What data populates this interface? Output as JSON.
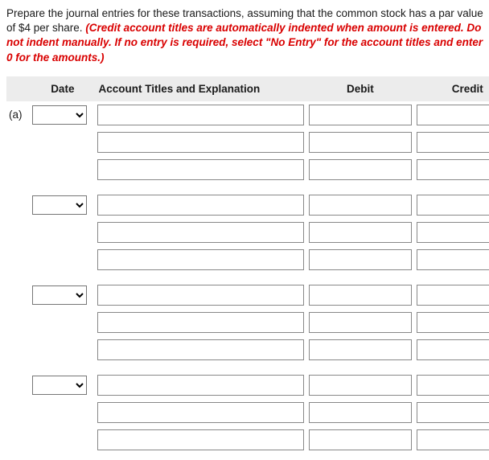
{
  "instructions": {
    "lead": "Prepare the journal entries for these transactions, assuming that the common stock has a par value of $4 per share. ",
    "warn": "(Credit account titles are automatically indented when amount is entered. Do not indent manually. If no entry is required, select \"No Entry\" for the account titles and enter 0 for the amounts.)"
  },
  "headers": {
    "date": "Date",
    "account": "Account Titles and Explanation",
    "debit": "Debit",
    "credit": "Credit"
  },
  "part_label": "(a)",
  "groups": [
    {
      "date": "",
      "rows": [
        {
          "account": "",
          "debit": "",
          "credit": ""
        },
        {
          "account": "",
          "debit": "",
          "credit": ""
        },
        {
          "account": "",
          "debit": "",
          "credit": ""
        }
      ]
    },
    {
      "date": "",
      "rows": [
        {
          "account": "",
          "debit": "",
          "credit": ""
        },
        {
          "account": "",
          "debit": "",
          "credit": ""
        },
        {
          "account": "",
          "debit": "",
          "credit": ""
        }
      ]
    },
    {
      "date": "",
      "rows": [
        {
          "account": "",
          "debit": "",
          "credit": ""
        },
        {
          "account": "",
          "debit": "",
          "credit": ""
        },
        {
          "account": "",
          "debit": "",
          "credit": ""
        }
      ]
    },
    {
      "date": "",
      "rows": [
        {
          "account": "",
          "debit": "",
          "credit": ""
        },
        {
          "account": "",
          "debit": "",
          "credit": ""
        },
        {
          "account": "",
          "debit": "",
          "credit": ""
        }
      ]
    }
  ]
}
